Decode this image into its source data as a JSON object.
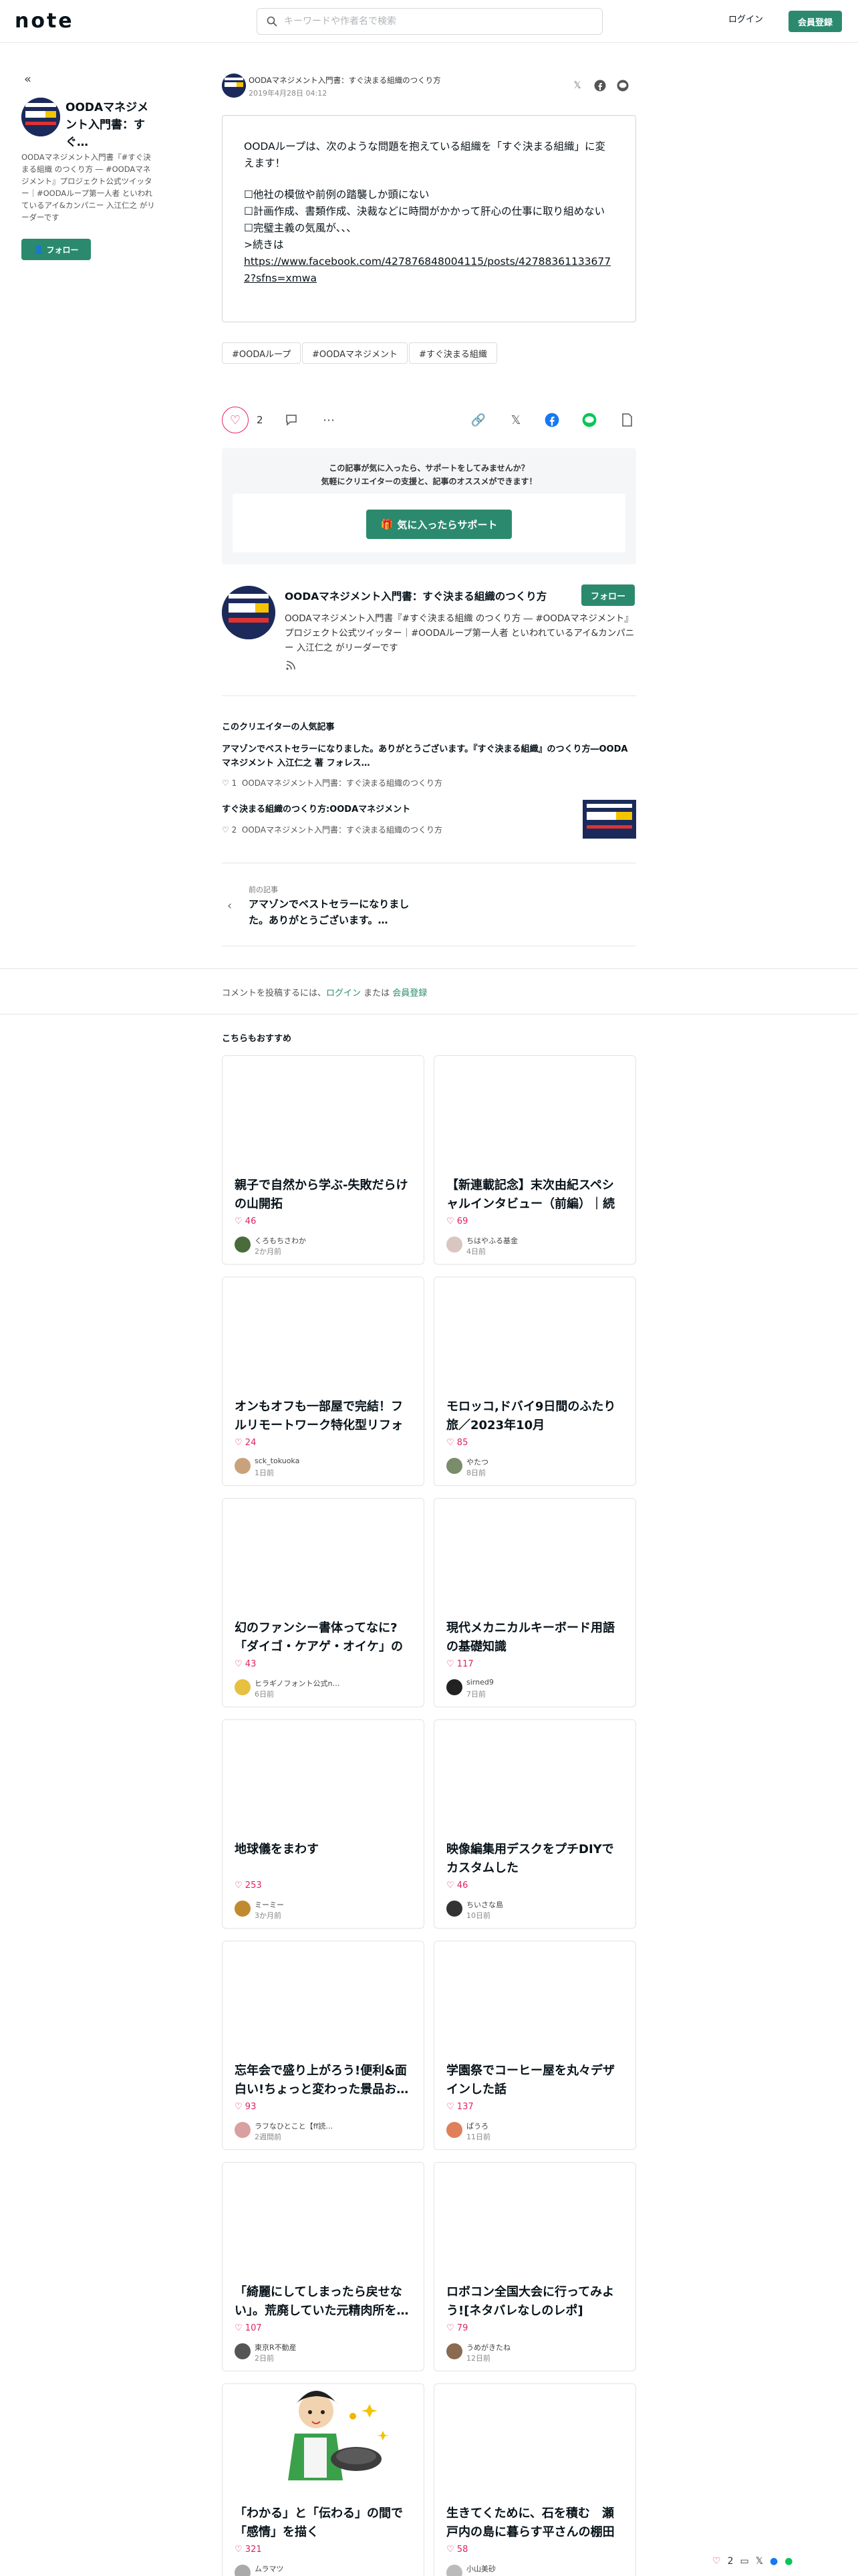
{
  "header": {
    "logo": "note",
    "search_placeholder": "キーワードや作者名で検索",
    "login": "ログイン",
    "signup": "会員登録"
  },
  "sidebar": {
    "name": "OODAマネジメント入門書：すぐ…",
    "bio": "OODAマネジメント入門書『#すぐ決まる組織 のつくり方 ― #OODAマネジメント』プロジェクト公式ツイッター｜#OODAループ第一人者 といわれているアイ&カンパニー 入江仁之 がリーダーです",
    "follow": "フォロー"
  },
  "byline": {
    "name": "OODAマネジメント入門書：すぐ決まる組織のつくり方",
    "date": "2019年4月28日 04:12"
  },
  "embed": {
    "line1": "OODAループは、次のような問題を抱えている組織を「すぐ決まる組織」に変えます！",
    "line2": "☐他社の模倣や前例の踏襲しか頭にない",
    "line3": "☐計画作成、書類作成、決裁などに時間がかかって肝心の仕事に取り組めない",
    "line4": "☐完璧主義の気風が、、、",
    "line5": ">続きは",
    "link": "https://www.facebook.com/427876848004115/posts/427883611336772?sfns=xmwa"
  },
  "tags": [
    "#OODAループ",
    "#OODAマネジメント",
    "#すぐ決まる組織"
  ],
  "likes": "2",
  "support": {
    "text1": "この記事が気に入ったら、サポートをしてみませんか？",
    "text2": "気軽にクリエイターの支援と、記事のオススメができます！",
    "button": "気に入ったらサポート"
  },
  "creator": {
    "name": "OODAマネジメント入門書：すぐ決まる組織のつくり方",
    "follow": "フォロー",
    "bio": "OODAマネジメント入門書『#すぐ決まる組織 のつくり方 ― #OODAマネジメント』プロジェクト公式ツイッター｜#OODAループ第一人者 といわれているアイ&カンパニー 入江仁之 がリーダーです"
  },
  "popular": {
    "title": "このクリエイターの人気記事",
    "items": [
      {
        "title": "アマゾンでベストセラーになりました。ありがとうございます。『すぐ決まる組織』のつくり方―OODAマネジメント 入江仁之 著 フォレス…",
        "likes": "1",
        "author": "OODAマネジメント入門書：すぐ決まる組織のつくり方"
      },
      {
        "title": "すぐ決まる組織のつくり方:OODAマネジメント",
        "likes": "2",
        "author": "OODAマネジメント入門書：すぐ決まる組織のつくり方"
      }
    ]
  },
  "prev": {
    "label": "前の記事",
    "title": "アマゾンでベストセラーになりました。ありがとうございます。…"
  },
  "comment": {
    "prefix": "コメントを投稿するには、",
    "login": "ログイン",
    "or": " または ",
    "signup": "会員登録"
  },
  "recommend": {
    "title": "こちらもおすすめ",
    "cards": [
      {
        "title": "親子で自然から学ぶ-失敗だらけの山開拓",
        "likes": "46",
        "author": "くろもちさわか",
        "time": "2か月前"
      },
      {
        "title": "【新連載記念】末次由紀スペシャルインタビュー（前編）｜続編…",
        "likes": "69",
        "author": "ちはやふる基金",
        "time": "4日前"
      },
      {
        "title": "オンもオフも一部屋で完結！フルリモートワーク特化型リフォー…",
        "likes": "24",
        "author": "sck_tokuoka",
        "time": "1日前"
      },
      {
        "title": "モロッコ,ドバイ9日間のふたり旅／2023年10月",
        "likes": "85",
        "author": "やたつ",
        "time": "8日前"
      },
      {
        "title": "幻のファンシー書体ってなに?「ダイゴ・ケアゲ・オイケ」の不思議…",
        "likes": "43",
        "author": "ヒラギノフォント公式n…",
        "time": "6日前"
      },
      {
        "title": "現代メカニカルキーボード用語の基礎知識",
        "likes": "117",
        "author": "sirned9",
        "time": "7日前"
      },
      {
        "title": "地球儀をまわす",
        "likes": "253",
        "author": "ミーミー",
        "time": "3か月前"
      },
      {
        "title": "映像編集用デスクをプチDIYでカスタムした",
        "likes": "46",
        "author": "ちいさな島",
        "time": "10日前"
      },
      {
        "title": "忘年会で盛り上がろう!便利&面白い!ちょっと変わった景品お…",
        "likes": "93",
        "author": "ラフなひとこと【ff読…",
        "time": "2週間前"
      },
      {
        "title": "学園祭でコーヒー屋を丸々デザインした話",
        "likes": "137",
        "author": "ぱうろ",
        "time": "11日前"
      },
      {
        "title": "「綺麗にしてしまったら戻せない」。荒廃していた元精肉所を…",
        "likes": "107",
        "author": "東京R不動産",
        "time": "2日前"
      },
      {
        "title": "ロボコン全国大会に行ってみよう![ネタバレなしのレポ]",
        "likes": "79",
        "author": "うめがきたね",
        "time": "12日前"
      },
      {
        "title": "「わかる」と「伝わる」の間で「感情」を描く",
        "likes": "321",
        "author": "ムラマツ",
        "time": ""
      },
      {
        "title": "生きてくために、石を積む　瀬戸内の島に暮らす平さんの棚田",
        "likes": "58",
        "author": "小山美砂",
        "time": ""
      }
    ]
  },
  "bottom_bar": {
    "likes": "2"
  }
}
